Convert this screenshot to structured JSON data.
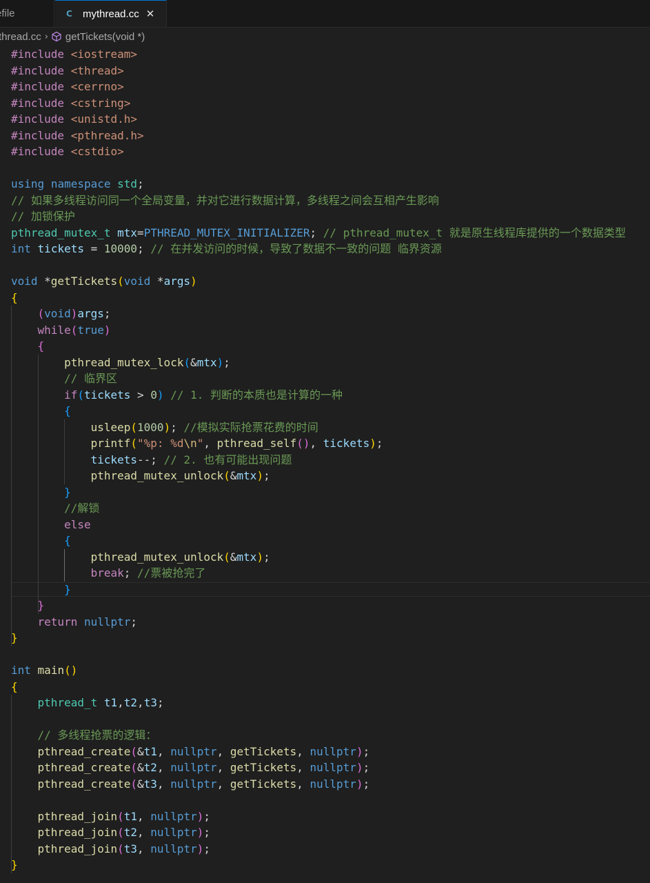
{
  "tabs": [
    {
      "label": "efile",
      "active": false
    },
    {
      "label": "mythread.cc",
      "active": true,
      "icon": "cpp-file-icon",
      "icon_glyph": "C",
      "close_glyph": "✕"
    }
  ],
  "breadcrumb": {
    "file": "thread.cc",
    "separator": "›",
    "symbol": "getTickets(void *)",
    "symbol_icon": "method-icon"
  },
  "theme": {
    "keyword": "#569cd6",
    "control": "#c586c0",
    "type": "#4ec9b0",
    "function": "#dcdcaa",
    "variable": "#9cdcfe",
    "string": "#ce9178",
    "number": "#b5cea8",
    "comment": "#6a9955",
    "accent": "#0078d4"
  },
  "code": {
    "current_line": 33,
    "lines": [
      [
        [
          "#include",
          "pp"
        ],
        [
          " ",
          ""
        ],
        [
          "<iostream>",
          "inc"
        ]
      ],
      [
        [
          "#include",
          "pp"
        ],
        [
          " ",
          ""
        ],
        [
          "<thread>",
          "inc"
        ]
      ],
      [
        [
          "#include",
          "pp"
        ],
        [
          " ",
          ""
        ],
        [
          "<cerrno>",
          "inc"
        ]
      ],
      [
        [
          "#include",
          "pp"
        ],
        [
          " ",
          ""
        ],
        [
          "<cstring>",
          "inc"
        ]
      ],
      [
        [
          "#include",
          "pp"
        ],
        [
          " ",
          ""
        ],
        [
          "<unistd.h>",
          "inc"
        ]
      ],
      [
        [
          "#include",
          "pp"
        ],
        [
          " ",
          ""
        ],
        [
          "<pthread.h>",
          "inc"
        ]
      ],
      [
        [
          "#include",
          "pp"
        ],
        [
          " ",
          ""
        ],
        [
          "<cstdio>",
          "inc"
        ]
      ],
      [],
      [
        [
          "using",
          "kw"
        ],
        [
          " ",
          ""
        ],
        [
          "namespace",
          "kw"
        ],
        [
          " ",
          ""
        ],
        [
          "std",
          "ns"
        ],
        [
          ";",
          "pn"
        ]
      ],
      [
        [
          "// 如果多线程访问同一个全局变量，并对它进行数据计算，多线程之间会互相产生影响",
          "com"
        ]
      ],
      [
        [
          "// 加锁保护",
          "com"
        ]
      ],
      [
        [
          "pthread_mutex_t",
          "ty"
        ],
        [
          " ",
          ""
        ],
        [
          "mtx",
          "var"
        ],
        [
          "=",
          "pn"
        ],
        [
          "PTHREAD_MUTEX_INITIALIZER",
          "mac"
        ],
        [
          ";",
          "pn"
        ],
        [
          " ",
          ""
        ],
        [
          "// pthread_mutex_t 就是原生线程库提供的一个数据类型",
          "com"
        ]
      ],
      [
        [
          "int",
          "kw"
        ],
        [
          " ",
          ""
        ],
        [
          "tickets",
          "var"
        ],
        [
          " = ",
          "pn"
        ],
        [
          "10000",
          "num"
        ],
        [
          ";",
          "pn"
        ],
        [
          " ",
          ""
        ],
        [
          "// 在并发访问的时候，导致了数据不一致的问题 临界资源",
          "com"
        ]
      ],
      [],
      [
        [
          "void",
          "kw"
        ],
        [
          " *",
          "pn"
        ],
        [
          "getTickets",
          "fn"
        ],
        [
          "(",
          "b1"
        ],
        [
          "void",
          "kw"
        ],
        [
          " *",
          "pn"
        ],
        [
          "args",
          "var"
        ],
        [
          ")",
          "b1"
        ]
      ],
      [
        [
          "{",
          "b1"
        ]
      ],
      [
        [
          "    ",
          ""
        ],
        [
          "(",
          "b2"
        ],
        [
          "void",
          "kw"
        ],
        [
          ")",
          "b2"
        ],
        [
          "args",
          "var"
        ],
        [
          ";",
          "pn"
        ]
      ],
      [
        [
          "    ",
          ""
        ],
        [
          "while",
          "ctl"
        ],
        [
          "(",
          "b2"
        ],
        [
          "true",
          "kw"
        ],
        [
          ")",
          "b2"
        ]
      ],
      [
        [
          "    ",
          ""
        ],
        [
          "{",
          "b2"
        ]
      ],
      [
        [
          "        ",
          ""
        ],
        [
          "pthread_mutex_lock",
          "fn"
        ],
        [
          "(",
          "b3"
        ],
        [
          "&",
          "pn"
        ],
        [
          "mtx",
          "var"
        ],
        [
          ")",
          "b3"
        ],
        [
          ";",
          "pn"
        ]
      ],
      [
        [
          "        ",
          ""
        ],
        [
          "// 临界区",
          "com"
        ]
      ],
      [
        [
          "        ",
          ""
        ],
        [
          "if",
          "ctl"
        ],
        [
          "(",
          "b3"
        ],
        [
          "tickets",
          "var"
        ],
        [
          " > ",
          "pn"
        ],
        [
          "0",
          "num"
        ],
        [
          ")",
          "b3"
        ],
        [
          " ",
          ""
        ],
        [
          "// 1. 判断的本质也是计算的一种",
          "com"
        ]
      ],
      [
        [
          "        ",
          ""
        ],
        [
          "{",
          "b3"
        ]
      ],
      [
        [
          "            ",
          ""
        ],
        [
          "usleep",
          "fn"
        ],
        [
          "(",
          "b1"
        ],
        [
          "1000",
          "num"
        ],
        [
          ")",
          "b1"
        ],
        [
          ";",
          "pn"
        ],
        [
          " ",
          ""
        ],
        [
          "//模拟实际抢票花费的时间",
          "com"
        ]
      ],
      [
        [
          "            ",
          ""
        ],
        [
          "printf",
          "fn"
        ],
        [
          "(",
          "b1"
        ],
        [
          "\"%p: %d",
          "str"
        ],
        [
          "\\n",
          "esc"
        ],
        [
          "\"",
          "str"
        ],
        [
          ", ",
          "pn"
        ],
        [
          "pthread_self",
          "fn"
        ],
        [
          "(",
          "b2"
        ],
        [
          ")",
          "b2"
        ],
        [
          ", ",
          "pn"
        ],
        [
          "tickets",
          "var"
        ],
        [
          ")",
          "b1"
        ],
        [
          ";",
          "pn"
        ]
      ],
      [
        [
          "            ",
          ""
        ],
        [
          "tickets",
          "var"
        ],
        [
          "--;",
          "pn"
        ],
        [
          " ",
          ""
        ],
        [
          "// 2. 也有可能出现问题",
          "com"
        ]
      ],
      [
        [
          "            ",
          ""
        ],
        [
          "pthread_mutex_unlock",
          "fn"
        ],
        [
          "(",
          "b1"
        ],
        [
          "&",
          "pn"
        ],
        [
          "mtx",
          "var"
        ],
        [
          ")",
          "b1"
        ],
        [
          ";",
          "pn"
        ]
      ],
      [
        [
          "        ",
          ""
        ],
        [
          "}",
          "b3"
        ]
      ],
      [
        [
          "        ",
          ""
        ],
        [
          "//解锁",
          "com"
        ]
      ],
      [
        [
          "        ",
          ""
        ],
        [
          "else",
          "ctl"
        ]
      ],
      [
        [
          "        ",
          ""
        ],
        [
          "{",
          "b3"
        ]
      ],
      [
        [
          "            ",
          ""
        ],
        [
          "pthread_mutex_unlock",
          "fn"
        ],
        [
          "(",
          "b1"
        ],
        [
          "&",
          "pn"
        ],
        [
          "mtx",
          "var"
        ],
        [
          ")",
          "b1"
        ],
        [
          ";",
          "pn"
        ]
      ],
      [
        [
          "            ",
          ""
        ],
        [
          "break",
          "ctl"
        ],
        [
          ";",
          "pn"
        ],
        [
          " ",
          ""
        ],
        [
          "//票被抢完了",
          "com"
        ]
      ],
      [
        [
          "        ",
          ""
        ],
        [
          "}",
          "b3"
        ]
      ],
      [
        [
          "    ",
          ""
        ],
        [
          "}",
          "b2"
        ]
      ],
      [
        [
          "    ",
          ""
        ],
        [
          "return",
          "ctl"
        ],
        [
          " ",
          ""
        ],
        [
          "nullptr",
          "kw"
        ],
        [
          ";",
          "pn"
        ]
      ],
      [
        [
          "}",
          "b1"
        ]
      ],
      [],
      [
        [
          "int",
          "kw"
        ],
        [
          " ",
          ""
        ],
        [
          "main",
          "fn"
        ],
        [
          "()",
          "b1"
        ]
      ],
      [
        [
          "{",
          "b1"
        ]
      ],
      [
        [
          "    ",
          ""
        ],
        [
          "pthread_t",
          "ty"
        ],
        [
          " ",
          ""
        ],
        [
          "t1",
          "var"
        ],
        [
          ",",
          "pn"
        ],
        [
          "t2",
          "var"
        ],
        [
          ",",
          "pn"
        ],
        [
          "t3",
          "var"
        ],
        [
          ";",
          "pn"
        ]
      ],
      [],
      [
        [
          "    ",
          ""
        ],
        [
          "// 多线程抢票的逻辑：",
          "com"
        ]
      ],
      [
        [
          "    ",
          ""
        ],
        [
          "pthread_create",
          "fn"
        ],
        [
          "(",
          "b2"
        ],
        [
          "&",
          "pn"
        ],
        [
          "t1",
          "var"
        ],
        [
          ", ",
          "pn"
        ],
        [
          "nullptr",
          "kw"
        ],
        [
          ", ",
          "pn"
        ],
        [
          "getTickets",
          "fn"
        ],
        [
          ", ",
          "pn"
        ],
        [
          "nullptr",
          "kw"
        ],
        [
          ")",
          "b2"
        ],
        [
          ";",
          "pn"
        ]
      ],
      [
        [
          "    ",
          ""
        ],
        [
          "pthread_create",
          "fn"
        ],
        [
          "(",
          "b2"
        ],
        [
          "&",
          "pn"
        ],
        [
          "t2",
          "var"
        ],
        [
          ", ",
          "pn"
        ],
        [
          "nullptr",
          "kw"
        ],
        [
          ", ",
          "pn"
        ],
        [
          "getTickets",
          "fn"
        ],
        [
          ", ",
          "pn"
        ],
        [
          "nullptr",
          "kw"
        ],
        [
          ")",
          "b2"
        ],
        [
          ";",
          "pn"
        ]
      ],
      [
        [
          "    ",
          ""
        ],
        [
          "pthread_create",
          "fn"
        ],
        [
          "(",
          "b2"
        ],
        [
          "&",
          "pn"
        ],
        [
          "t3",
          "var"
        ],
        [
          ", ",
          "pn"
        ],
        [
          "nullptr",
          "kw"
        ],
        [
          ", ",
          "pn"
        ],
        [
          "getTickets",
          "fn"
        ],
        [
          ", ",
          "pn"
        ],
        [
          "nullptr",
          "kw"
        ],
        [
          ")",
          "b2"
        ],
        [
          ";",
          "pn"
        ]
      ],
      [],
      [
        [
          "    ",
          ""
        ],
        [
          "pthread_join",
          "fn"
        ],
        [
          "(",
          "b2"
        ],
        [
          "t1",
          "var"
        ],
        [
          ", ",
          "pn"
        ],
        [
          "nullptr",
          "kw"
        ],
        [
          ")",
          "b2"
        ],
        [
          ";",
          "pn"
        ]
      ],
      [
        [
          "    ",
          ""
        ],
        [
          "pthread_join",
          "fn"
        ],
        [
          "(",
          "b2"
        ],
        [
          "t2",
          "var"
        ],
        [
          ", ",
          "pn"
        ],
        [
          "nullptr",
          "kw"
        ],
        [
          ")",
          "b2"
        ],
        [
          ";",
          "pn"
        ]
      ],
      [
        [
          "    ",
          ""
        ],
        [
          "pthread_join",
          "fn"
        ],
        [
          "(",
          "b2"
        ],
        [
          "t3",
          "var"
        ],
        [
          ", ",
          "pn"
        ],
        [
          "nullptr",
          "kw"
        ],
        [
          ")",
          "b2"
        ],
        [
          ";",
          "pn"
        ]
      ],
      [
        [
          "}",
          "b1"
        ]
      ]
    ]
  }
}
